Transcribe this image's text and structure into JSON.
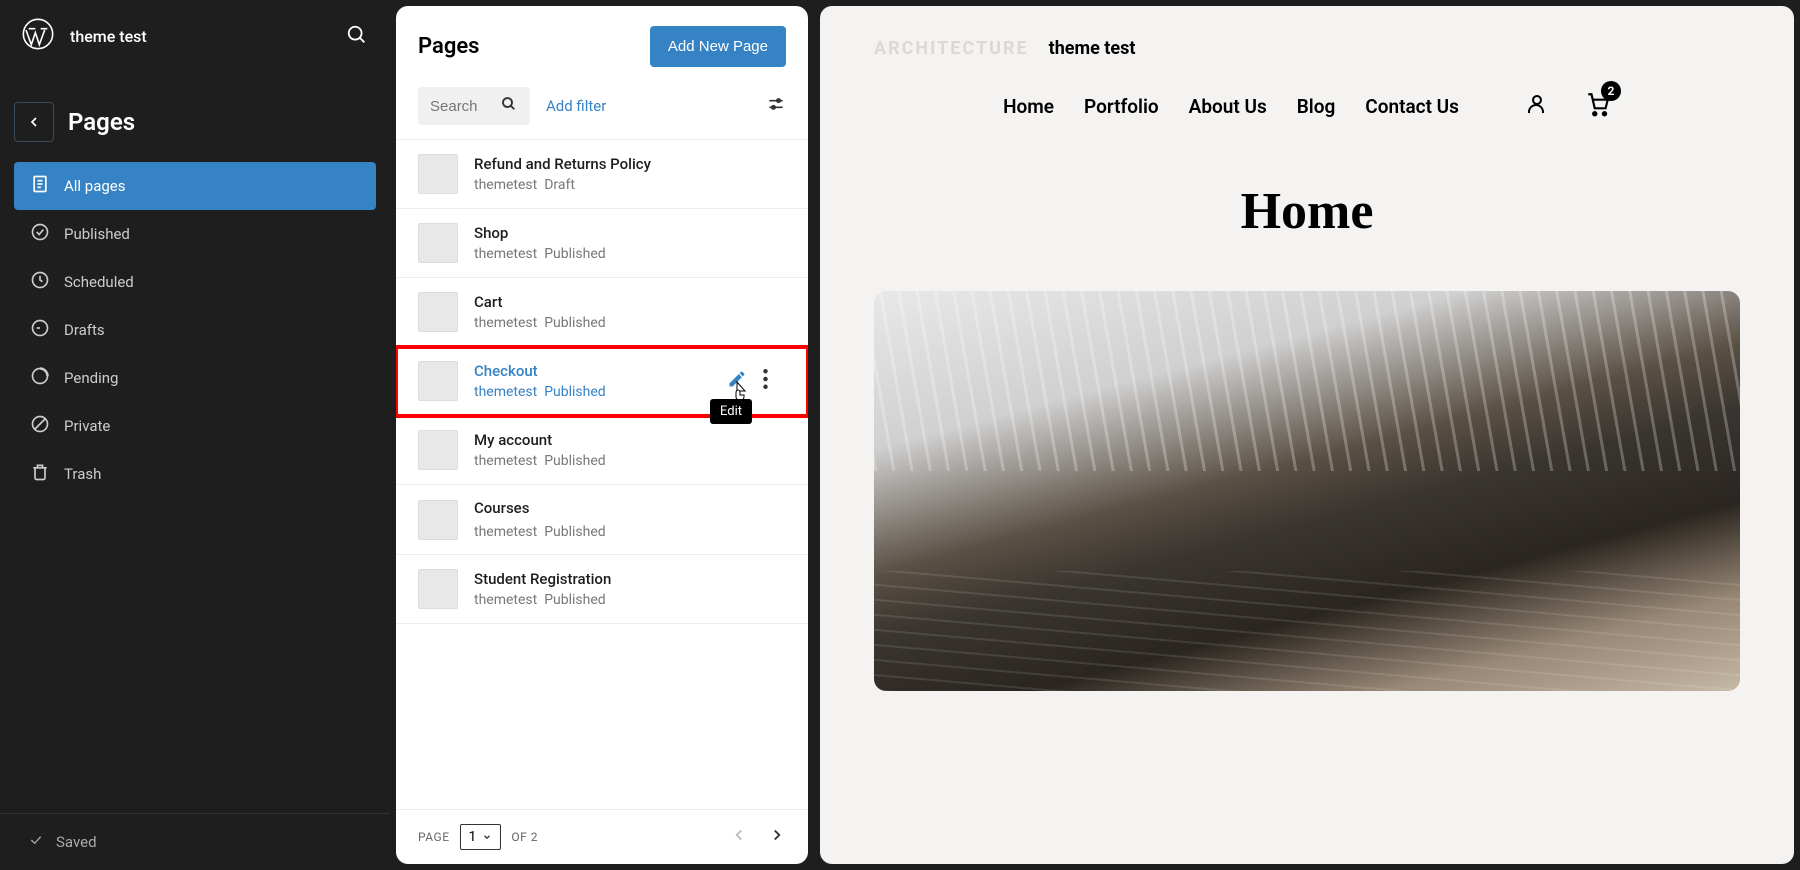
{
  "site_title": "theme test",
  "nav": {
    "title": "Pages",
    "items": [
      {
        "label": "All pages",
        "icon": "doc"
      },
      {
        "label": "Published",
        "icon": "check"
      },
      {
        "label": "Scheduled",
        "icon": "clock"
      },
      {
        "label": "Drafts",
        "icon": "draft"
      },
      {
        "label": "Pending",
        "icon": "pending"
      },
      {
        "label": "Private",
        "icon": "block"
      },
      {
        "label": "Trash",
        "icon": "trash"
      }
    ]
  },
  "footer": {
    "saved": "Saved"
  },
  "panel": {
    "title": "Pages",
    "add_button": "Add New Page",
    "search_placeholder": "Search",
    "add_filter": "Add filter",
    "edit_tooltip": "Edit"
  },
  "pages": [
    {
      "title": "Refund and Returns Policy",
      "author": "themetest",
      "status": "Draft"
    },
    {
      "title": "Shop",
      "author": "themetest",
      "status": "Published"
    },
    {
      "title": "Cart",
      "author": "themetest",
      "status": "Published"
    },
    {
      "title": "Checkout",
      "author": "themetest",
      "status": "Published"
    },
    {
      "title": "My account",
      "author": "themetest",
      "status": "Published"
    },
    {
      "title": "Courses",
      "author": "themetest",
      "status": "Published"
    },
    {
      "title": "Student Registration",
      "author": "themetest",
      "status": "Published"
    }
  ],
  "pagination": {
    "page_label": "PAGE",
    "current": "1",
    "of_label": "OF",
    "total": "2"
  },
  "preview": {
    "brand_muted": "ARCHITECTURE",
    "brand": "theme test",
    "menu": [
      "Home",
      "Portfolio",
      "About Us",
      "Blog",
      "Contact Us"
    ],
    "cart_count": "2",
    "hero_title": "Home"
  }
}
